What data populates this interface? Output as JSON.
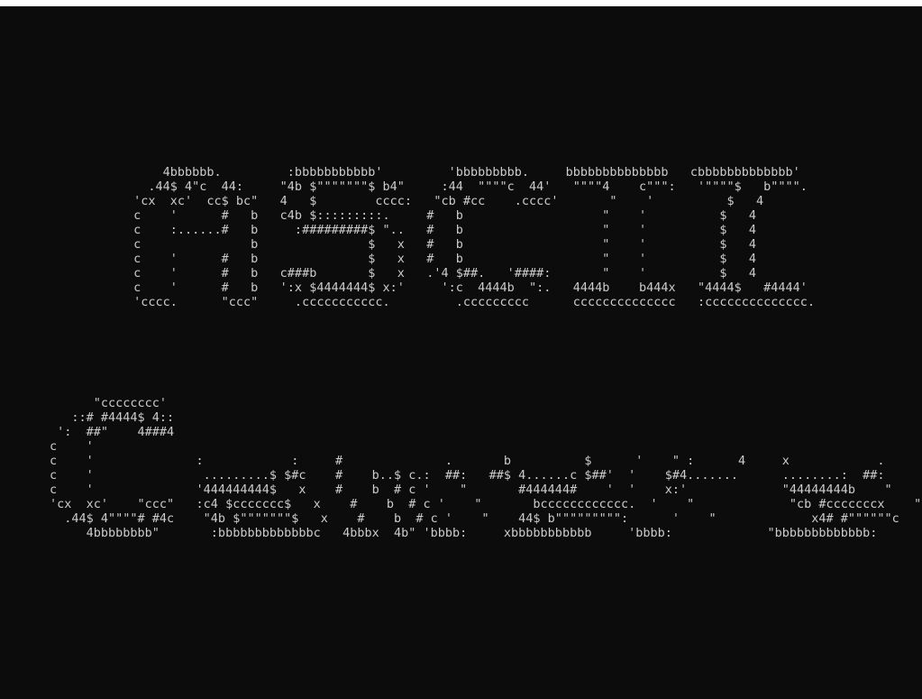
{
  "terminal": {
    "theme": {
      "background": "#0c0c0c",
      "foreground": "#cccccc",
      "border": "#ffffff"
    },
    "banner_top": [
      "     4bbbbbb.         :bbbbbbbbbbb'         'bbbbbbbbb.     bbbbbbbbbbbbbb   cbbbbbbbbbbbbb'",
      "   .44$ 4\"c  44:     \"4b $\"\"\"\"\"\"\"$ b4\"     :44  \"\"\"\"c  44'   \"\"\"\"4    c\"\"\":   '\"\"\"\"$   b\"\"\"\".",
      " 'cx  xc'  cc$ bc\"   4   $        cccc:   \"cb #cc    .cccc'       \"    '          $   4",
      " c    '      #   b   c4b $:::::::::.     #   b                   \"    '          $   4",
      " c    :......#   b     :#########$ \"..   #   b                   \"    '          $   4",
      " c               b               $   x   #   b                   \"    '          $   4",
      " c    '      #   b               $   x   #   b                   \"    '          $   4",
      " c    '      #   b   c###b       $   x   .'4 $##.   '####:       \"    '          $   4",
      " c    '      #   b   ':x $4444444$ x:'     ':c  4444b  \":.   4444b    b444x   \"4444$   #4444'",
      " 'cccc.      \"ccc\"     .ccccccccccc.         .ccccccccc      cccccccccccccc   :cccccccccccccc."
    ],
    "banner_bottom": [
      "      \"cccccccc'",
      "   ::# #4444$ 4::",
      " ':  ##\"    4###4",
      "c    '",
      "c    '              :            :     #              .       b          $      '    \" :      4     x            .",
      "c    '               .........$ $#c    #    b..$ c.:  ##:   ##$ 4......c $##'  '    $#4.......      ........:  ##:",
      "c    '              '444444444$   x    #    b  # c '    \"       #444444#    '  '    x:'             \"44444444b    \"",
      "'cx  xc'    \"ccc\"   :c4 $ccccccc$   x    #    b  # c '    \"       bcccccccccccc.  '    \"             \"cb #cccccccx    \"",
      "  .44$ 4\"\"\"\"# #4c    \"4b $\"\"\"\"\"\"\"$   x    #    b  # c '    \"    44$ b\"\"\"\"\"\"\"\"\":      '    \"             x4# #\"\"\"\"\"\"c    \"",
      "     4bbbbbbbb\"       :bbbbbbbbbbbbbc   4bbbx  4b\" 'bbbb:     xbbbbbbbbbbb     'bbbb:             \"bbbbbbbbbbbbb:"
    ]
  }
}
